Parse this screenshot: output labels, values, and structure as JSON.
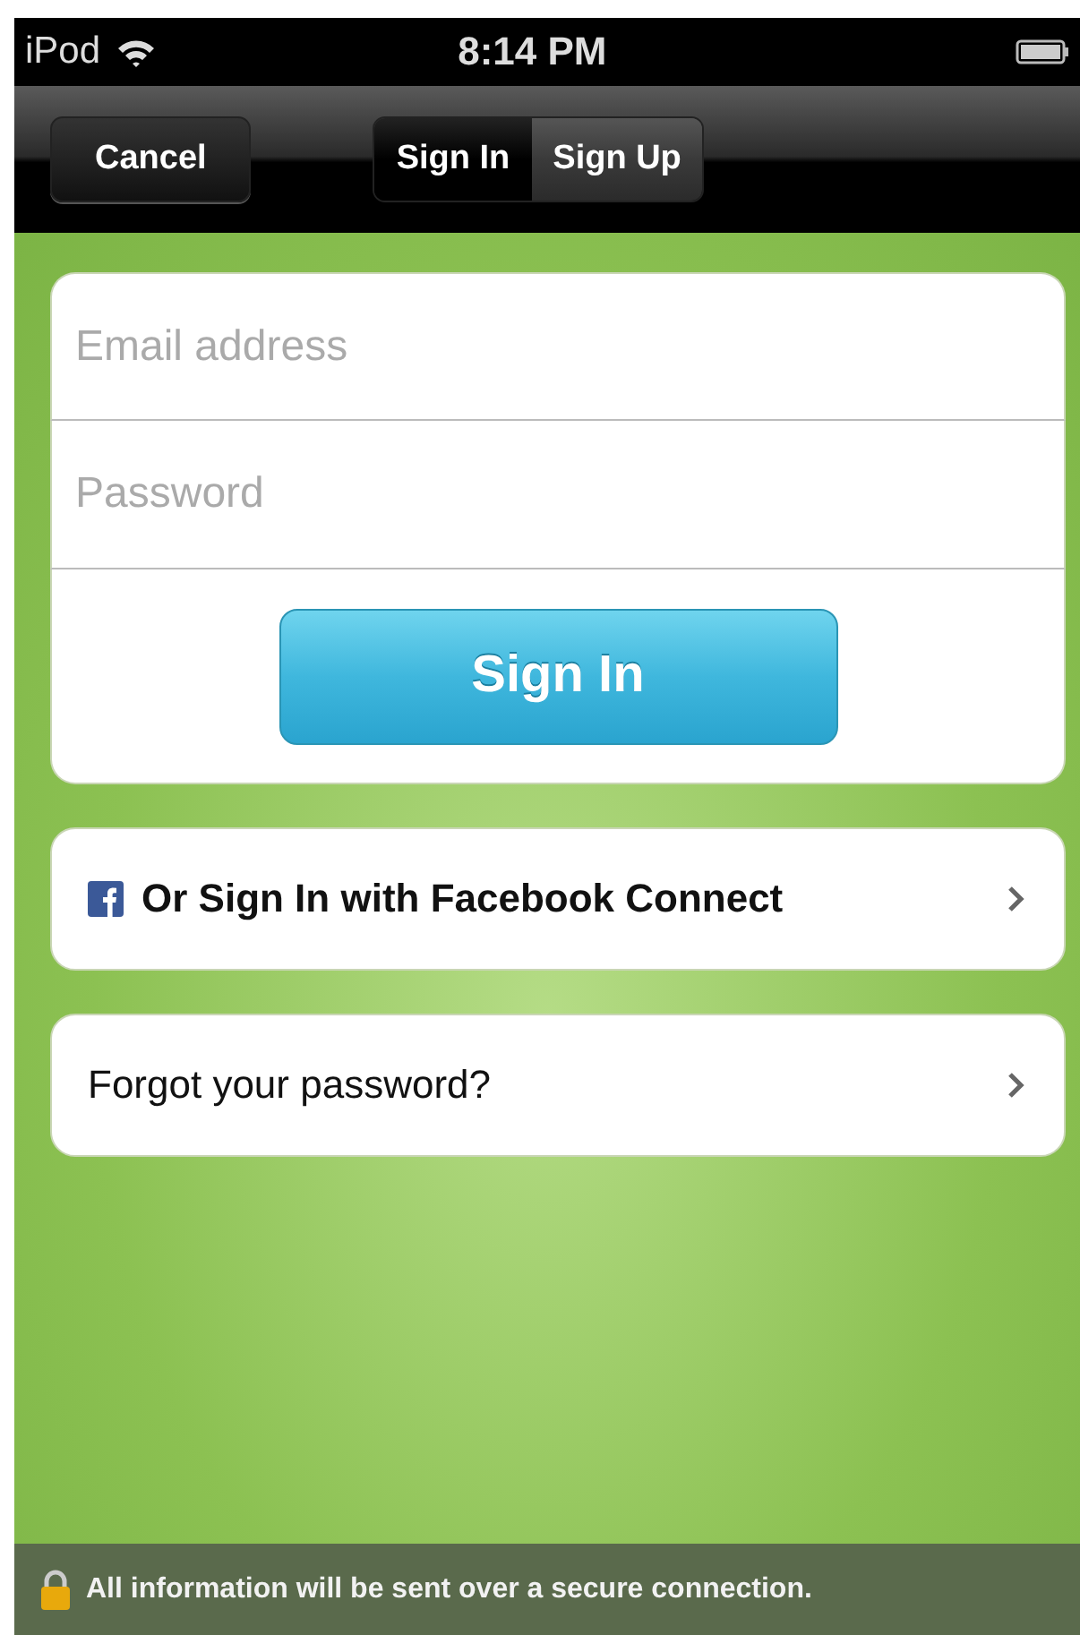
{
  "status_bar": {
    "carrier": "iPod",
    "time": "8:14 PM"
  },
  "nav_bar": {
    "cancel": "Cancel",
    "segments": [
      {
        "label": "Sign In",
        "selected": true
      },
      {
        "label": "Sign Up",
        "selected": false
      }
    ]
  },
  "form": {
    "email": {
      "placeholder": "Email address"
    },
    "password": {
      "placeholder": "Password"
    },
    "submit": "Sign In"
  },
  "links": [
    {
      "kind": "facebook",
      "label": "Or Sign In with Facebook Connect"
    },
    {
      "kind": "plain",
      "label": "Forgot your password?"
    }
  ],
  "footer": {
    "text": "All information will be sent over a secure connection."
  }
}
